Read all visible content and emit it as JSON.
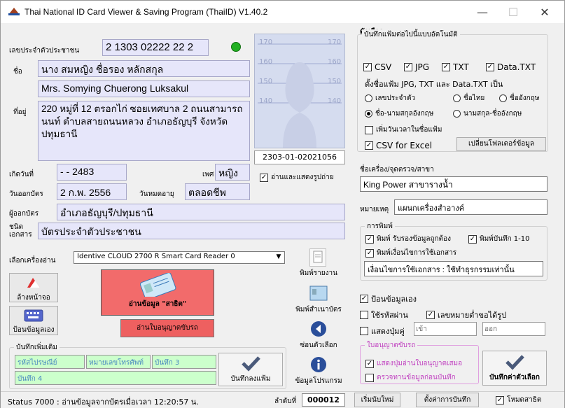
{
  "window": {
    "title": "Thai National ID Card Viewer & Saving Program (ThaiID) V1.40.2"
  },
  "card": {
    "id_label": "เลขประจำตัวประชาชน",
    "id_value": "2 1303 02222 22 2",
    "name_label": "ชื่อ",
    "name_th": "นาง สมหญิง ชื่อรอง หลักสกุล",
    "name_en": "Mrs. Somying Chuerong Luksakul",
    "address_label": "ที่อยู่",
    "address": "220 หมู่ที่ 12 ตรอกไก่ ซอยเทศบาล 2 ถนนสามารถนนท์ ตำบลสายถนนหลวง อำเภอธัญบุรี จังหวัดปทุมธานี",
    "birth_label": "เกิดวันที่",
    "birth_value": "- - 2483",
    "sex_label": "เพศ",
    "sex_value": "หญิง",
    "issue_label": "วันออกบัตร",
    "issue_value": "2 ก.พ. 2556",
    "expire_label": "วันหมดอายุ",
    "expire_value": "ตลอดชีพ",
    "issuer_label": "ผู้ออกบัตร",
    "issuer_value": "อำเภอธัญบุรี/ปทุมธานี",
    "doctype_label1": "ชนิด",
    "doctype_label2": "เอกสาร",
    "doctype_value": "บัตรประจำตัวประชาชน",
    "photo_id": "2303-01-02021056",
    "photo_scale": [
      "170",
      "160",
      "150",
      "140"
    ],
    "show_photo_label": "อ่านและแสดงรูปถ่าย"
  },
  "reader": {
    "label": "เลือกเครื่องอ่าน",
    "selected": "Identive CLOUD 2700 R Smart Card Reader 0"
  },
  "buttons": {
    "clear": "ล้างหน้าจอ",
    "manual": "ป้อนข้อมูลเอง",
    "read": "อ่านข้อมูล \"สาธิต\"",
    "read_license": "อ่านใบอนุญาตขับรถ",
    "print_report": "พิมพ์รายงาน",
    "print_card": "พิมพ์สำเนาบัตร",
    "back": "ซ่อนตัวเลือก",
    "about": "ข้อมูลโปรแกรม",
    "save_extra": "บันทึกลงแฟ้ม",
    "save_options": "บันทึกค่าตัวเลือก",
    "new_page": "เริ่มนับใหม่",
    "save_settings": "ตั้งค่าการบันทึก"
  },
  "extra": {
    "title": "บันทึกเพิ่มเติม",
    "field1": "รหัสไปรษณีย์",
    "field2": "หมายเลขโทรศัพท์",
    "field3": "บันทึก 3",
    "field4": "บันทึก 4"
  },
  "options": {
    "title": "ตัวเลือก",
    "autosave_title": "บันทึกแฟ้มต่อไปนี้แบบอัตโนมัติ",
    "csv": "CSV",
    "jpg": "JPG",
    "txt": "TXT",
    "datatxt": "Data.TXT",
    "naming_title": "ตั้งชื่อแฟ้ม JPG, TXT และ Data.TXT เป็น",
    "naming": [
      "เลขประจำตัว",
      "ชื่อไทย",
      "ชื่ออังกฤษ",
      "ชื่อ-นามสกุลอังกฤษ",
      "นามสกุล-ชื่ออังกฤษ"
    ],
    "add_time": "เพิ่มวันเวลาในชื่อแฟ้ม",
    "csv_excel": "CSV for Excel",
    "change_folder": "เปลี่ยนโฟลเดอร์ข้อมูล",
    "machine_label": "ชื่อเครื่อง/จุดตรวจ/สาขา",
    "machine_value": "King Power สาขารางน้ำ",
    "note_label": "หมายเหตุ",
    "note_value": "แผนกเครื่องสำอางค์",
    "print_title": "การพิมพ์",
    "print1": "พิมพ์ รับรองข้อมูลถูกต้อง",
    "print2": "พิมพ์บันทึก 1-10",
    "print3": "พิมพ์เงื่อนไขการใช้เอกสาร",
    "condition_value": "เงื่อนไขการใช้เอกสาร : ใช้ทำธุรกรรมเท่านั้น",
    "manual_entry": "ป้อนข้อมูลเอง",
    "password": "ใช้รหัสผ่าน",
    "hide_id": "เลขหมายต่ำขอได้รูป",
    "show_btn": "แสดงปุ่มคู่",
    "enter_ph": "เข้า",
    "exit_ph": "ออก",
    "license_title": "ใบอนุญาตขับรถ",
    "license1": "แสดงปุ่มอ่านใบอนุญาตเสมอ",
    "license2": "ตรวจทานข้อมูลก่อนบันทึก",
    "demo_mode": "โหมดสาธิต"
  },
  "status": {
    "text": "Status 7000 : อ่านข้อมูลจากบัตรเมื่อเวลา 12:20:57 น.",
    "seq_label": "ลำดับที่",
    "seq_value": "000012"
  },
  "colors": {
    "field_bg": "#e6e6fa",
    "read_button": "#f26b6b",
    "license_button": "#ee6060",
    "status_led": "#22b022",
    "extra_field_bg": "#ccffcc",
    "license_group_border": "#e0a0e0"
  }
}
